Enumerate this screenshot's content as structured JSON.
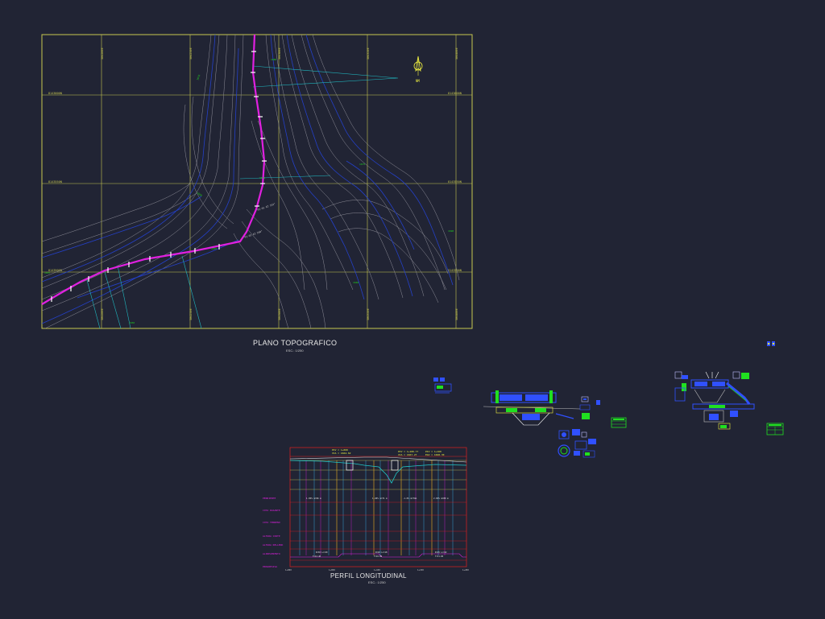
{
  "drawing": {
    "plan_title": "PLANO TOPOGRAFICO",
    "plan_scale": "ESC.: 1/250",
    "profile_title": "PERFIL LONGITUDINAL",
    "profile_scale": "ESC.: 1/250"
  },
  "grid_labels": {
    "north": [
      "8143600N",
      "8143550N",
      "8143500N"
    ],
    "east": [
      "304200E",
      "304250E",
      "304300E",
      "304350E",
      "304400E"
    ]
  },
  "profile_row_labels": [
    "PENDIENTE",
    "COTA RASANTE",
    "COTA TERRENO",
    "ALTURA CORTE",
    "ALTURA RELLENO",
    "ALINEAMIENTO",
    "PROGRESIVA"
  ],
  "colors": {
    "background": "#212434",
    "frame": "#c8c850",
    "contour": "#9a9aa4",
    "contour_index": "#2440c8",
    "alignment": "#e020e0",
    "cyan": "#20c8c8",
    "green": "#20e020",
    "red": "#e02020",
    "blue": "#3050ff",
    "yellow": "#f0f040"
  },
  "icons": [
    "north-arrow-icon"
  ]
}
